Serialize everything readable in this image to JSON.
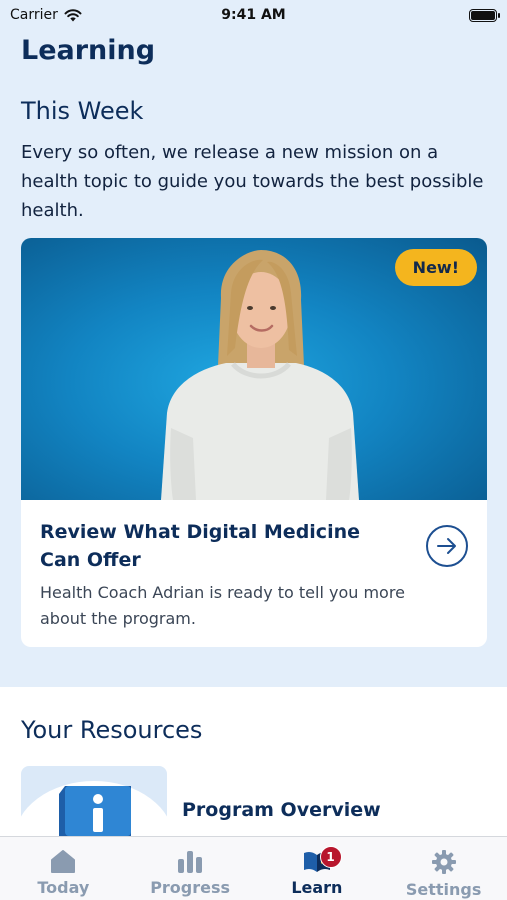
{
  "status_bar": {
    "carrier": "Carrier",
    "time": "9:41 AM"
  },
  "page": {
    "title": "Learning"
  },
  "this_week": {
    "title": "This Week",
    "intro": "Every so often, we release a new mission on a health topic to guide you towards the best possible health."
  },
  "featured_card": {
    "badge": "New!",
    "title": "Review What Digital Medicine Can Offer",
    "description": "Health Coach Adrian is ready to tell you more about the program."
  },
  "resources": {
    "title": "Your Resources",
    "items": [
      {
        "label": "Program Overview",
        "icon": "info-icon"
      }
    ]
  },
  "tabs": [
    {
      "label": "Today",
      "icon": "home-icon"
    },
    {
      "label": "Progress",
      "icon": "bar-chart-icon"
    },
    {
      "label": "Learn",
      "icon": "book-icon",
      "badge": "1"
    },
    {
      "label": "Settings",
      "icon": "gear-icon"
    }
  ],
  "colors": {
    "accent": "#f4b51e",
    "primary": "#0d2d5a",
    "badge": "#b8162d",
    "background": "#e3eefa"
  }
}
